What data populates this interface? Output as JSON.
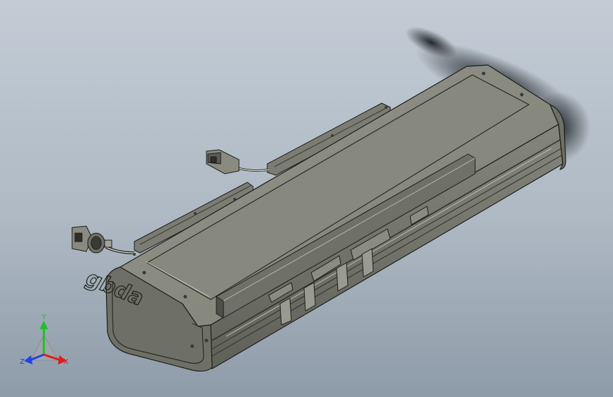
{
  "viewport": {
    "background_top": "#c3ccd5",
    "background_mid": "#aeb9c4",
    "background_bottom": "#8e9ba8"
  },
  "model": {
    "brand_mark": "gbda",
    "body_color": "#7d7e73",
    "top_color": "#8b8c81",
    "edge_color": "#1d1e1a",
    "carriage_color": "#6f7067"
  },
  "triad": {
    "x_label": "X",
    "y_label": "Y",
    "z_label": "Z",
    "x_color": "#e11b1b",
    "y_color": "#1fbf2a",
    "z_color": "#2244e0"
  }
}
